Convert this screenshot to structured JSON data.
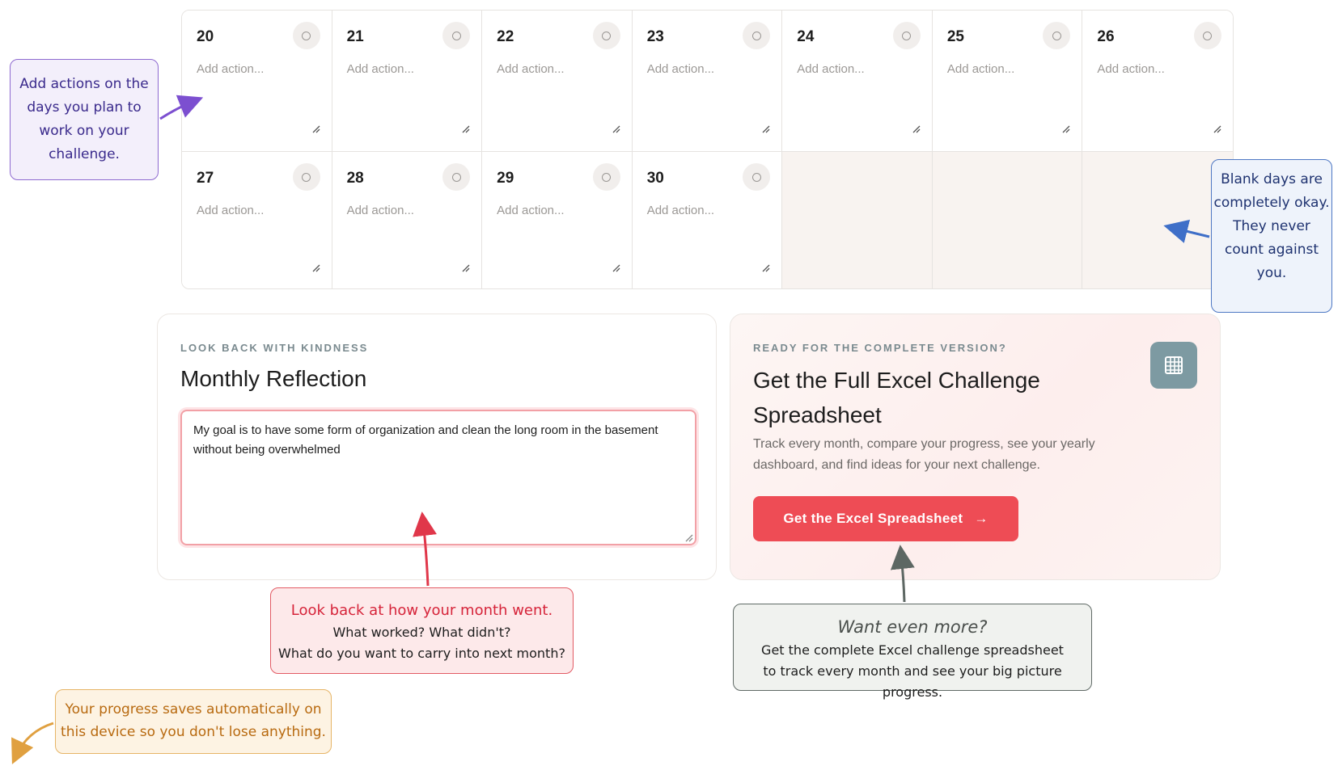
{
  "calendar": {
    "action_placeholder": "Add action...",
    "days": [
      {
        "num": "20",
        "action": "Add action..."
      },
      {
        "num": "21",
        "action": "Add action..."
      },
      {
        "num": "22",
        "action": "Add action..."
      },
      {
        "num": "23",
        "action": "Add action..."
      },
      {
        "num": "24",
        "action": "Add action..."
      },
      {
        "num": "25",
        "action": "Add action..."
      },
      {
        "num": "26",
        "action": "Add action..."
      },
      {
        "num": "27",
        "action": "Add action..."
      },
      {
        "num": "28",
        "action": "Add action..."
      },
      {
        "num": "29",
        "action": "Add action..."
      },
      {
        "num": "30",
        "action": "Add action..."
      }
    ],
    "blank_days": 3
  },
  "reflection": {
    "eyebrow": "LOOK BACK WITH KINDNESS",
    "title": "Monthly Reflection",
    "value": "My goal is to have some form of organization and clean the long room in the basement without being overwhelmed"
  },
  "upsell": {
    "eyebrow": "READY FOR THE COMPLETE VERSION?",
    "title": "Get the Full Excel Challenge Spreadsheet",
    "description": "Track every month, compare your progress, see your yearly dashboard, and find ideas for your next challenge.",
    "button_label": "Get the Excel Spreadsheet",
    "button_arrow": "→",
    "icon": "spreadsheet-grid-icon"
  },
  "annotations": {
    "purple": "Add actions on the days you plan to work on your challenge.",
    "blue": "Blank days are completely okay. They never count against you.",
    "red_title": "Look back at how your month went.",
    "red_line2": "What worked? What didn't?",
    "red_line3": "What do you want to carry into next month?",
    "gray_title": "Want even more?",
    "gray_line2": "Get the complete Excel challenge spreadsheet",
    "gray_line3": "to track every month and see your big picture progress.",
    "orange": "Your progress saves automatically on this device so you don't lose anything."
  },
  "colors": {
    "accent": "#ee4c55",
    "blank_cell": "#f8f3f0",
    "icon_tile": "#7d9aa2",
    "purple_note": "#8e6ad0",
    "blue_note": "#4e78c4",
    "red_note": "#e25a64",
    "gray_note": "#606a66",
    "orange_note": "#e6b466"
  }
}
